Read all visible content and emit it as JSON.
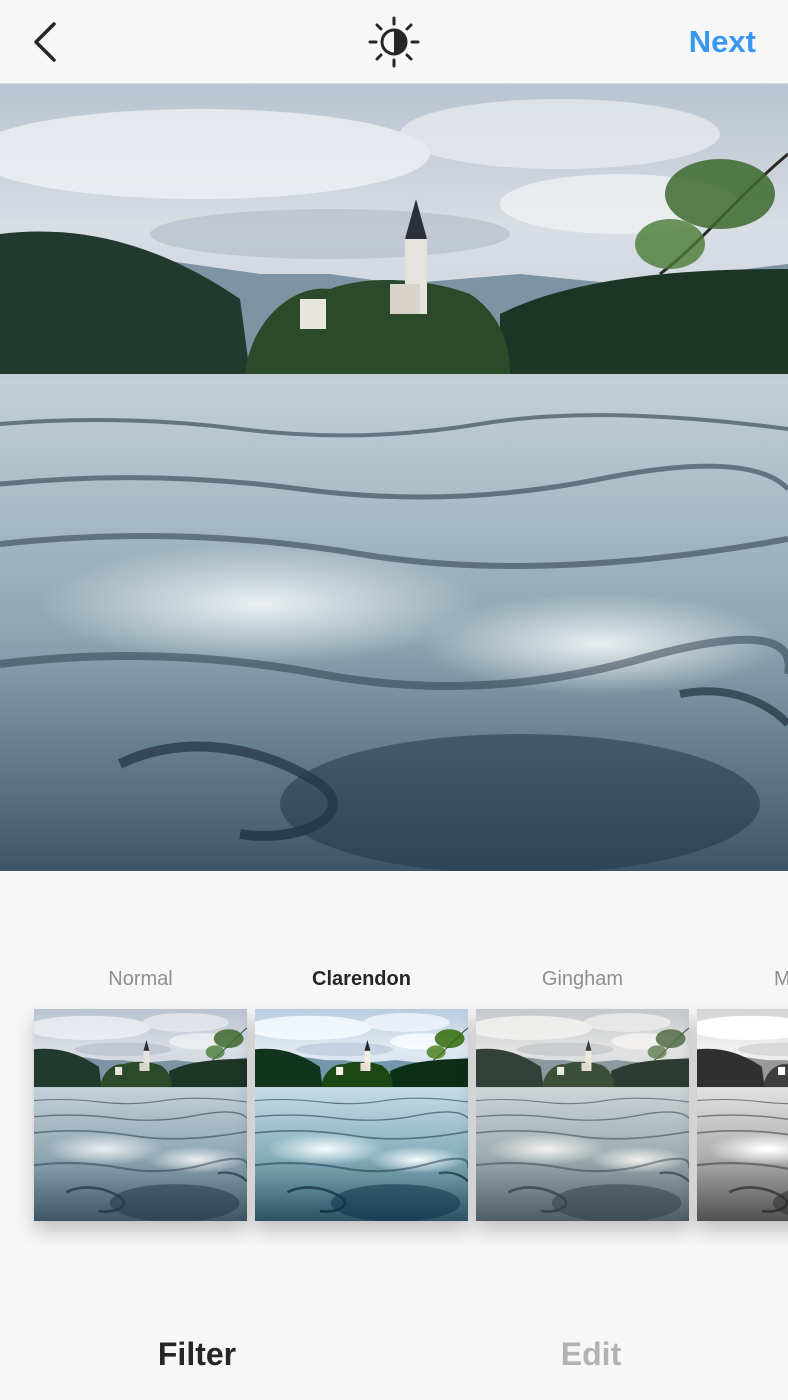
{
  "header": {
    "back_icon": "chevron-left-icon",
    "lux_icon": "sun-half-icon",
    "next_label": "Next",
    "accent_color": "#3897f0"
  },
  "photo": {
    "subject_icon": "lake-church-photo"
  },
  "filters": [
    {
      "name": "Normal",
      "selected": false
    },
    {
      "name": "Clarendon",
      "selected": true
    },
    {
      "name": "Gingham",
      "selected": false
    },
    {
      "name": "M",
      "selected": false
    }
  ],
  "tabs": {
    "filter_label": "Filter",
    "edit_label": "Edit"
  }
}
